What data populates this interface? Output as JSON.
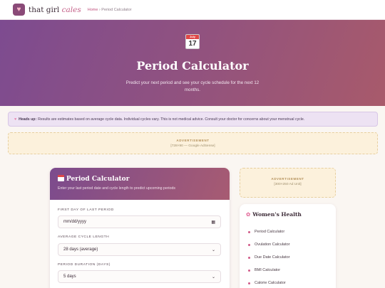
{
  "header": {
    "brand_main": "that girl",
    "brand_accent": "cales",
    "breadcrumb_home": "Home",
    "breadcrumb_sep": " › ",
    "breadcrumb_current": "Period Calculator"
  },
  "hero": {
    "icon": "calendar-icon",
    "icon_month": "July",
    "icon_day": "17",
    "title": "Period Calculator",
    "subtitle": "Predict your next period and see your cycle schedule for the next 12 months."
  },
  "notice": {
    "icon": "heart-icon",
    "label": "Heads up:",
    "text": "Results are estimates based on average cycle data. Individual cycles vary. This is not medical advice. Consult your doctor for concerns about your menstrual cycle."
  },
  "ad_top": {
    "label": "ADVERTISEMENT",
    "size": "[728×90 — Google AdSense]"
  },
  "calculator": {
    "title": "Period Calculator",
    "subtitle": "Enter your last period date and cycle length to predict upcoming periods",
    "fields": [
      {
        "label": "FIRST DAY OF LAST PERIOD",
        "placeholder": "mm/dd/yyyy"
      },
      {
        "label": "AVERAGE CYCLE LENGTH",
        "value": "28 days (average)"
      },
      {
        "label": "PERIOD DURATION (DAYS)",
        "value": "5 days"
      }
    ]
  },
  "ad_side": {
    "label": "ADVERTISEMENT",
    "size": "[300×250 Ad Unit]"
  },
  "sidebar": {
    "title": "Women's Health",
    "items": [
      {
        "label": "Period Calculator"
      },
      {
        "label": "Ovulation Calculator"
      },
      {
        "label": "Due Date Calculator"
      },
      {
        "label": "BMI Calculator"
      },
      {
        "label": "Calorie Calculator"
      }
    ]
  },
  "colors": {
    "accent": "#c04f7c",
    "hero_start": "#7d4b90",
    "hero_end": "#a85a6b"
  }
}
